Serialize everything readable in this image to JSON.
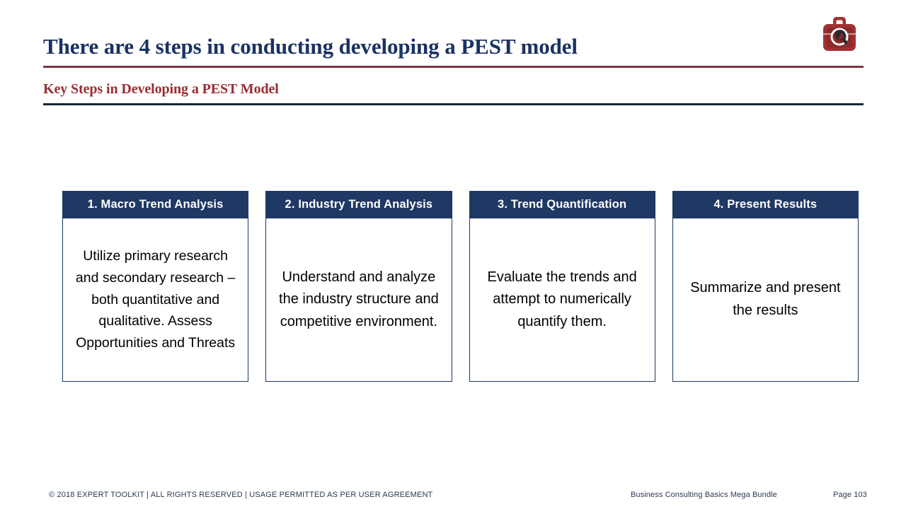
{
  "slide": {
    "title": "There are 4 steps in conducting developing a PEST model",
    "subtitle": "Key Steps in Developing a PEST Model",
    "colors": {
      "title_navy": "#1a3263",
      "subtitle_red": "#9a2d33",
      "rule_red": "#7b3440",
      "rule_navy": "#14263c",
      "card_header_navy": "#1f3864",
      "card_border_navy": "#17375e",
      "logo_red": "#a33131",
      "logo_dark_red": "#7c2424"
    }
  },
  "logo": {
    "name": "expert-toolkit-toolbox-wrench-logo"
  },
  "cards": [
    {
      "header": "1. Macro Trend Analysis",
      "body": "Utilize primary research and secondary research – both quantitative and qualitative. Assess Opportunities and Threats"
    },
    {
      "header": "2. Industry Trend Analysis",
      "body": "Understand and analyze the industry structure and competitive environment."
    },
    {
      "header": "3. Trend Quantification",
      "body": "Evaluate the trends and attempt to numerically quantify them."
    },
    {
      "header": "4. Present Results",
      "body": "Summarize and present the results"
    }
  ],
  "footer": {
    "copyright": "© 2018 EXPERT TOOLKIT | ALL RIGHTS RESERVED | USAGE PERMITTED AS PER USER AGREEMENT",
    "bundle": "Business Consulting Basics Mega Bundle",
    "page": "Page 103"
  }
}
